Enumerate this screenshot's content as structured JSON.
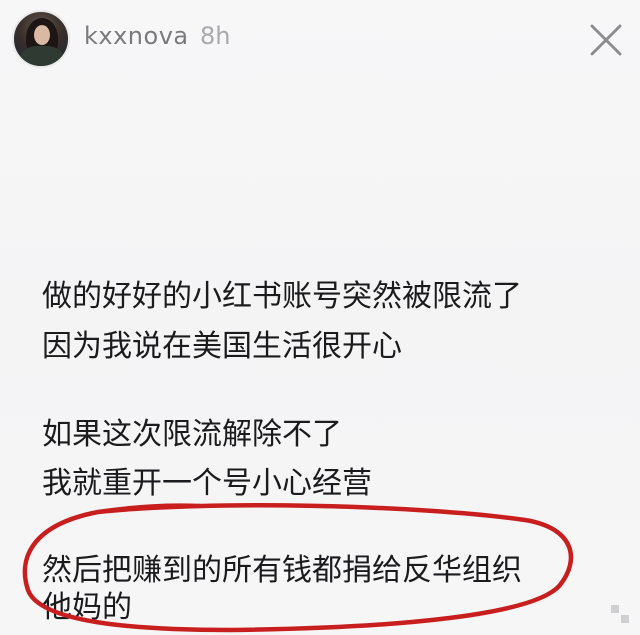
{
  "story": {
    "username": "kxxnova",
    "time": "8h",
    "lines": [
      "做的好好的小红书账号突然被限流了",
      "因为我说在美国生活很开心",
      "如果这次限流解除不了",
      "我就重开一个号小心经营",
      "然后把赚到的所有钱都捐给反华组织",
      "他妈的"
    ]
  },
  "icons": {
    "close": "close-icon",
    "avatar": "avatar"
  },
  "colors": {
    "annotation": "#c81e1e",
    "text": "#1b1b1d",
    "username": "#7a7a7e",
    "background": "#f5f5f6"
  }
}
